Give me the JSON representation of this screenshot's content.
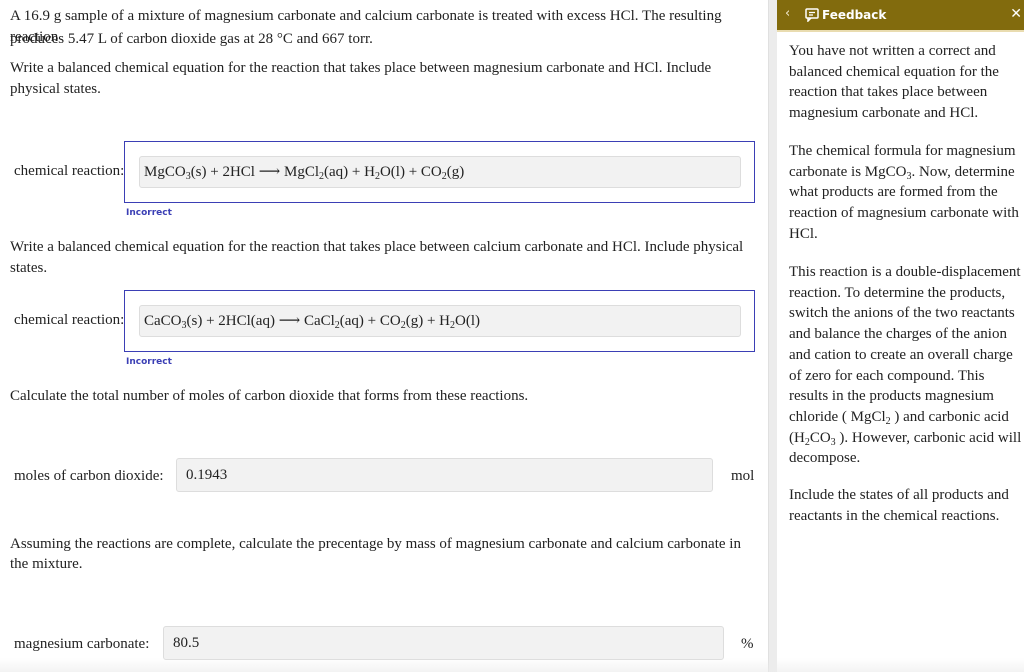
{
  "problem": {
    "intro_line1": "A 16.9 g sample of a mixture of magnesium carbonate and calcium carbonate is treated with excess HCl. The resulting reaction",
    "intro_line2": "produces 5.47 L of carbon dioxide gas at 28 °C and 667 torr.",
    "q1_line1": "Write a balanced chemical equation for the reaction that takes place between magnesium carbonate and HCl. Include",
    "q1_line2": "physical states.",
    "q2": "Write a balanced chemical equation for the reaction that takes place between calcium carbonate and HCl. Include physical states.",
    "q3": "Calculate the total number of moles of carbon dioxide that forms from these reactions.",
    "q4_line1": "Assuming the reactions are complete, calculate the precentage by mass of magnesium carbonate and calcium carbonate in",
    "q4_line2": "the mixture."
  },
  "answers": {
    "reaction1": {
      "label": "chemical reaction:",
      "parts": [
        "MgCO",
        "3",
        "(s) + 2HCl ⟶ MgCl",
        "2",
        "(aq) + H",
        "2",
        "O(l) + CO",
        "2",
        "(g)"
      ],
      "status": "Incorrect"
    },
    "reaction2": {
      "label": "chemical reaction:",
      "parts": [
        "CaCO",
        "3",
        "(s) + 2HCl(aq) ⟶ CaCl",
        "2",
        "(aq) + CO",
        "2",
        "(g) + H",
        "2",
        "O(l)"
      ],
      "status": "Incorrect"
    },
    "moles": {
      "label": "moles of carbon dioxide:",
      "value": "0.1943",
      "unit": "mol"
    },
    "mgco3_percent": {
      "label": "magnesium carbonate:",
      "value": "80.5",
      "unit": "%"
    }
  },
  "feedback": {
    "back_icon": "chevron-left-icon",
    "title": "Feedback",
    "title_icon": "feedback-speech-bubble-icon",
    "close_icon": "close-x-icon",
    "para1": "You have not written a correct and balanced chemical equation for the reaction that takes place between magnesium carbonate and HCl.",
    "para2_a": "The chemical formula for magnesium carbonate is MgCO",
    "para2_sub": "3",
    "para2_b": ". Now, determine what products are formed from the reaction of magnesium carbonate with HCl.",
    "para3_a": "This reaction is a double-displacement reaction. To determine the products, switch the anions of the two reactants and balance the charges of the anion and cation to create an overall charge of zero for each compound. This results in the products magnesium chloride ( MgCl",
    "para3_sub1": "2",
    "para3_b": " ) and carbonic acid (H",
    "para3_sub2": "2",
    "para3_c": "CO",
    "para3_sub3": "3",
    "para3_d": " ). However, carbonic acid will decompose.",
    "para4": "Include the states of all products and reactants in the chemical reactions."
  },
  "colors": {
    "feedback_header": "#826b0d",
    "answer_border": "#3b3fb5",
    "incorrect_text": "#3b3fb5",
    "field_bg": "#f2f2f2"
  }
}
